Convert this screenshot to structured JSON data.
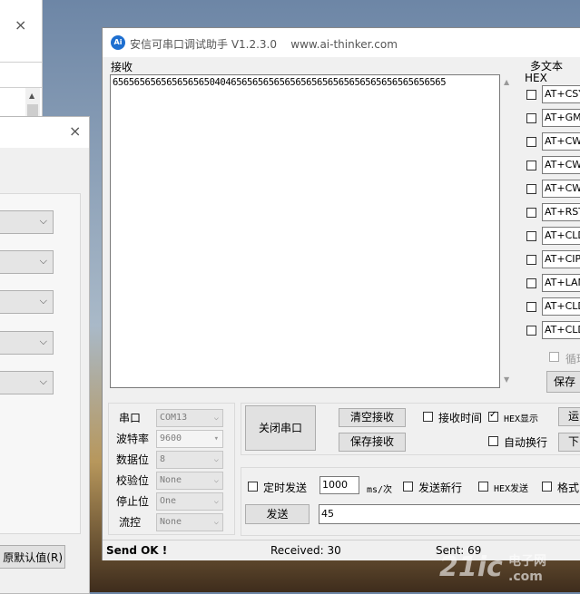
{
  "back_window_1": {
    "close_icon": "×",
    "scroll_up": "▲"
  },
  "back_window_2": {
    "close_icon": "×",
    "combo_arrow": "⌵",
    "restore_default_label": "原默认值(R)"
  },
  "window": {
    "title": "安信可串口调试助手 V1.2.3.0",
    "url": "www.ai-thinker.com",
    "logo_text": "Ai"
  },
  "receive": {
    "label": "接收",
    "content": "65656565656565656504046565656565656565656565656565656565656565"
  },
  "multi_text": {
    "label": "多文本",
    "hex_label": "HEX",
    "items": [
      "AT+CSYS",
      "AT+GMR",
      "AT+CWMODE",
      "AT+CWJAP",
      "AT+CWLAP",
      "AT+RST",
      "AT+CLDSTART",
      "AT+CIPSTART",
      "AT+LANSTART",
      "AT+CLDSEND",
      "AT+CLDSTOP"
    ],
    "loop_label": "循环",
    "save_label": "保存"
  },
  "serial": {
    "port_label": "串口",
    "port_value": "COM13",
    "baud_label": "波特率",
    "baud_value": "9600",
    "databits_label": "数据位",
    "databits_value": "8",
    "parity_label": "校验位",
    "parity_value": "None",
    "stopbits_label": "停止位",
    "stopbits_value": "One",
    "flow_label": "流控",
    "flow_value": "None"
  },
  "controls": {
    "close_port": "关闭串口",
    "clear_receive": "清空接收",
    "save_receive": "保存接收",
    "recv_time": "接收时间",
    "hex_display": "HEX显示",
    "auto_wrap": "自动换行",
    "run_label": "运",
    "down_label": "下"
  },
  "send": {
    "timed_send": "定时发送",
    "interval": "1000",
    "interval_unit": "ms/次",
    "send_newline": "发送新行",
    "hex_send": "HEX发送",
    "format_label": "格式",
    "send_button": "发送",
    "send_text": "45"
  },
  "status": {
    "send_ok": "Send OK !",
    "received": "Received: 30",
    "sent": "Sent: 69"
  },
  "watermark": {
    "main": "21ic",
    "sub": "电子网",
    "domain": ".com"
  }
}
